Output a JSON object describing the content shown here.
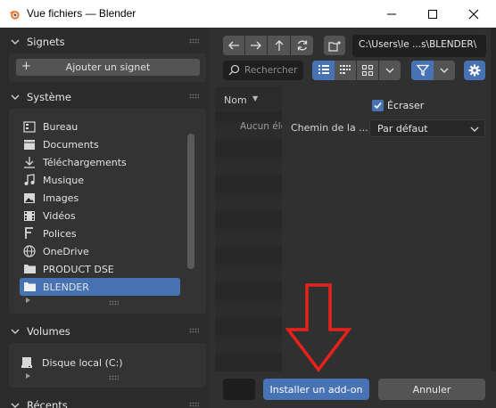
{
  "window": {
    "title": "Vue fichiers — Blender"
  },
  "sidebar": {
    "bookmarks": {
      "header": "Signets",
      "add_label": "Ajouter un signet"
    },
    "system": {
      "header": "Système",
      "items": [
        {
          "label": "Bureau",
          "icon": "desktop-icon",
          "selected": false
        },
        {
          "label": "Documents",
          "icon": "documents-icon",
          "selected": false
        },
        {
          "label": "Téléchargements",
          "icon": "download-icon",
          "selected": false
        },
        {
          "label": "Musique",
          "icon": "music-icon",
          "selected": false
        },
        {
          "label": "Images",
          "icon": "image-icon",
          "selected": false
        },
        {
          "label": "Vidéos",
          "icon": "video-icon",
          "selected": false
        },
        {
          "label": "Polices",
          "icon": "font-icon",
          "selected": false
        },
        {
          "label": "OneDrive",
          "icon": "globe-icon",
          "selected": false
        },
        {
          "label": "PRODUCT DSE",
          "icon": "folder-icon",
          "selected": false
        },
        {
          "label": "BLENDER",
          "icon": "folder-icon",
          "selected": true
        }
      ]
    },
    "volumes": {
      "header": "Volumes",
      "items": [
        {
          "label": "Disque local (C:)",
          "icon": "drive-icon"
        }
      ]
    },
    "recent": {
      "header": "Récents"
    }
  },
  "toolbar": {
    "path": "C:\\Users\\le ...s\\BLENDER\\",
    "search_placeholder": "Rechercher"
  },
  "file_list": {
    "column_name": "Nom",
    "empty_label": "Aucun élément"
  },
  "options": {
    "overwrite_label": "Écraser",
    "overwrite_checked": true,
    "path_label": "Chemin de la ...",
    "path_value": "Par défaut"
  },
  "footer": {
    "install_label": "Installer un add-on",
    "cancel_label": "Annuler"
  },
  "colors": {
    "accent": "#4772b3",
    "annotation_arrow": "#e8221a"
  }
}
